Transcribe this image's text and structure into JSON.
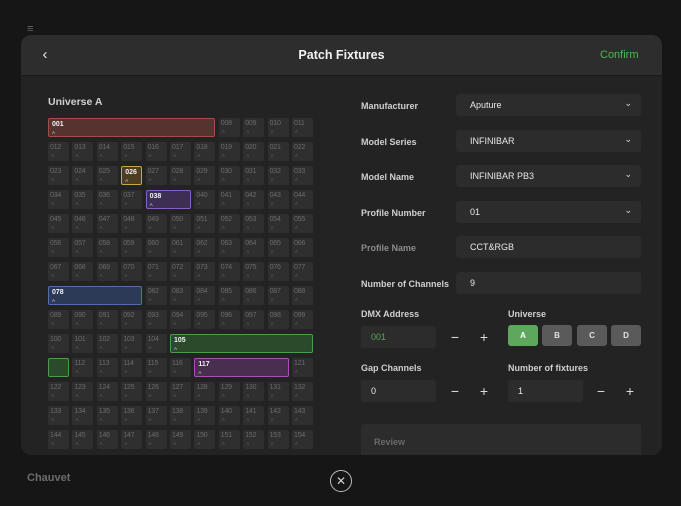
{
  "background": {
    "menu_icon": "hamburger-menu-icon",
    "footer_text": "Chauvet"
  },
  "modal": {
    "title": "Patch Fixtures",
    "back_icon": "chevron-left-icon",
    "confirm_label": "Confirm",
    "close_icon": "close-icon"
  },
  "universe_grid": {
    "title": "Universe A",
    "rows": [
      [
        "001",
        "002",
        "003",
        "004",
        "005",
        "006",
        "007",
        "008",
        "009",
        "010",
        "011"
      ],
      [
        "012",
        "013",
        "014",
        "015",
        "016",
        "017",
        "018",
        "019",
        "020",
        "021",
        "022"
      ],
      [
        "023",
        "024",
        "025",
        "026",
        "027",
        "028",
        "029",
        "030",
        "031",
        "032",
        "033"
      ],
      [
        "034",
        "035",
        "036",
        "037",
        "038",
        "039",
        "040",
        "041",
        "042",
        "043",
        "044"
      ],
      [
        "045",
        "046",
        "047",
        "048",
        "049",
        "050",
        "051",
        "052",
        "053",
        "054",
        "055"
      ],
      [
        "056",
        "057",
        "058",
        "059",
        "060",
        "061",
        "062",
        "063",
        "064",
        "065",
        "066"
      ],
      [
        "067",
        "068",
        "069",
        "070",
        "071",
        "072",
        "073",
        "074",
        "075",
        "076",
        "077"
      ],
      [
        "078",
        "079",
        "080",
        "081",
        "082",
        "083",
        "084",
        "085",
        "086",
        "087",
        "088"
      ],
      [
        "089",
        "090",
        "091",
        "092",
        "093",
        "094",
        "095",
        "096",
        "097",
        "098",
        "099"
      ],
      [
        "100",
        "101",
        "102",
        "103",
        "104",
        "105",
        "106",
        "107",
        "108",
        "109",
        "110"
      ],
      [
        "111",
        "112",
        "113",
        "114",
        "115",
        "116",
        "117",
        "118",
        "119",
        "120",
        "121"
      ],
      [
        "122",
        "123",
        "124",
        "125",
        "126",
        "127",
        "128",
        "129",
        "130",
        "131",
        "132"
      ],
      [
        "133",
        "134",
        "135",
        "136",
        "137",
        "138",
        "139",
        "140",
        "141",
        "142",
        "143"
      ],
      [
        "144",
        "145",
        "146",
        "147",
        "148",
        "149",
        "150",
        "151",
        "152",
        "153",
        "154"
      ]
    ],
    "fixtures": [
      {
        "start": "001",
        "universe": "A",
        "color": "red",
        "row": 0,
        "col": 0,
        "span": 7
      },
      {
        "start": "026",
        "universe": "A",
        "color": "yellow",
        "row": 2,
        "col": 3,
        "span": 1
      },
      {
        "start": "038",
        "universe": "A",
        "color": "purple",
        "row": 3,
        "col": 4,
        "span": 2
      },
      {
        "start": "078",
        "universe": "A",
        "color": "blue",
        "row": 7,
        "col": 0,
        "span": 4
      },
      {
        "start": "105",
        "universe": "A",
        "color": "green",
        "row": 9,
        "col": 5,
        "span": 6
      },
      {
        "start": "",
        "universe": "",
        "color": "green",
        "row": 10,
        "col": 0,
        "span": 1
      },
      {
        "start": "117",
        "universe": "A",
        "color": "magenta",
        "row": 10,
        "col": 6,
        "span": 4
      }
    ],
    "cell_universe_label": "A"
  },
  "form": {
    "manufacturer": {
      "label": "Manufacturer",
      "value": "Aputure"
    },
    "model_series": {
      "label": "Model Series",
      "value": "INFINIBAR"
    },
    "model_name": {
      "label": "Model Name",
      "value": "INFINIBAR PB3"
    },
    "profile_number": {
      "label": "Profile Number",
      "value": "01"
    },
    "profile_name": {
      "label": "Profile Name",
      "value": "CCT&RGB"
    },
    "channels": {
      "label": "Number of Channels",
      "value": "9"
    },
    "dmx": {
      "label": "DMX Address",
      "value": "001",
      "minus": "−",
      "plus": "+"
    },
    "universe": {
      "label": "Universe",
      "options": [
        "A",
        "B",
        "C",
        "D"
      ],
      "selected": "A"
    },
    "gap": {
      "label": "Gap Channels",
      "value": "0",
      "minus": "−",
      "plus": "+"
    },
    "fixtures_count": {
      "label": "Number of fixtures",
      "value": "1",
      "minus": "−",
      "plus": "+"
    },
    "review_label": "Review"
  },
  "colors": {
    "accent_green": "#52b752",
    "universe_active": "#5ea85e"
  }
}
